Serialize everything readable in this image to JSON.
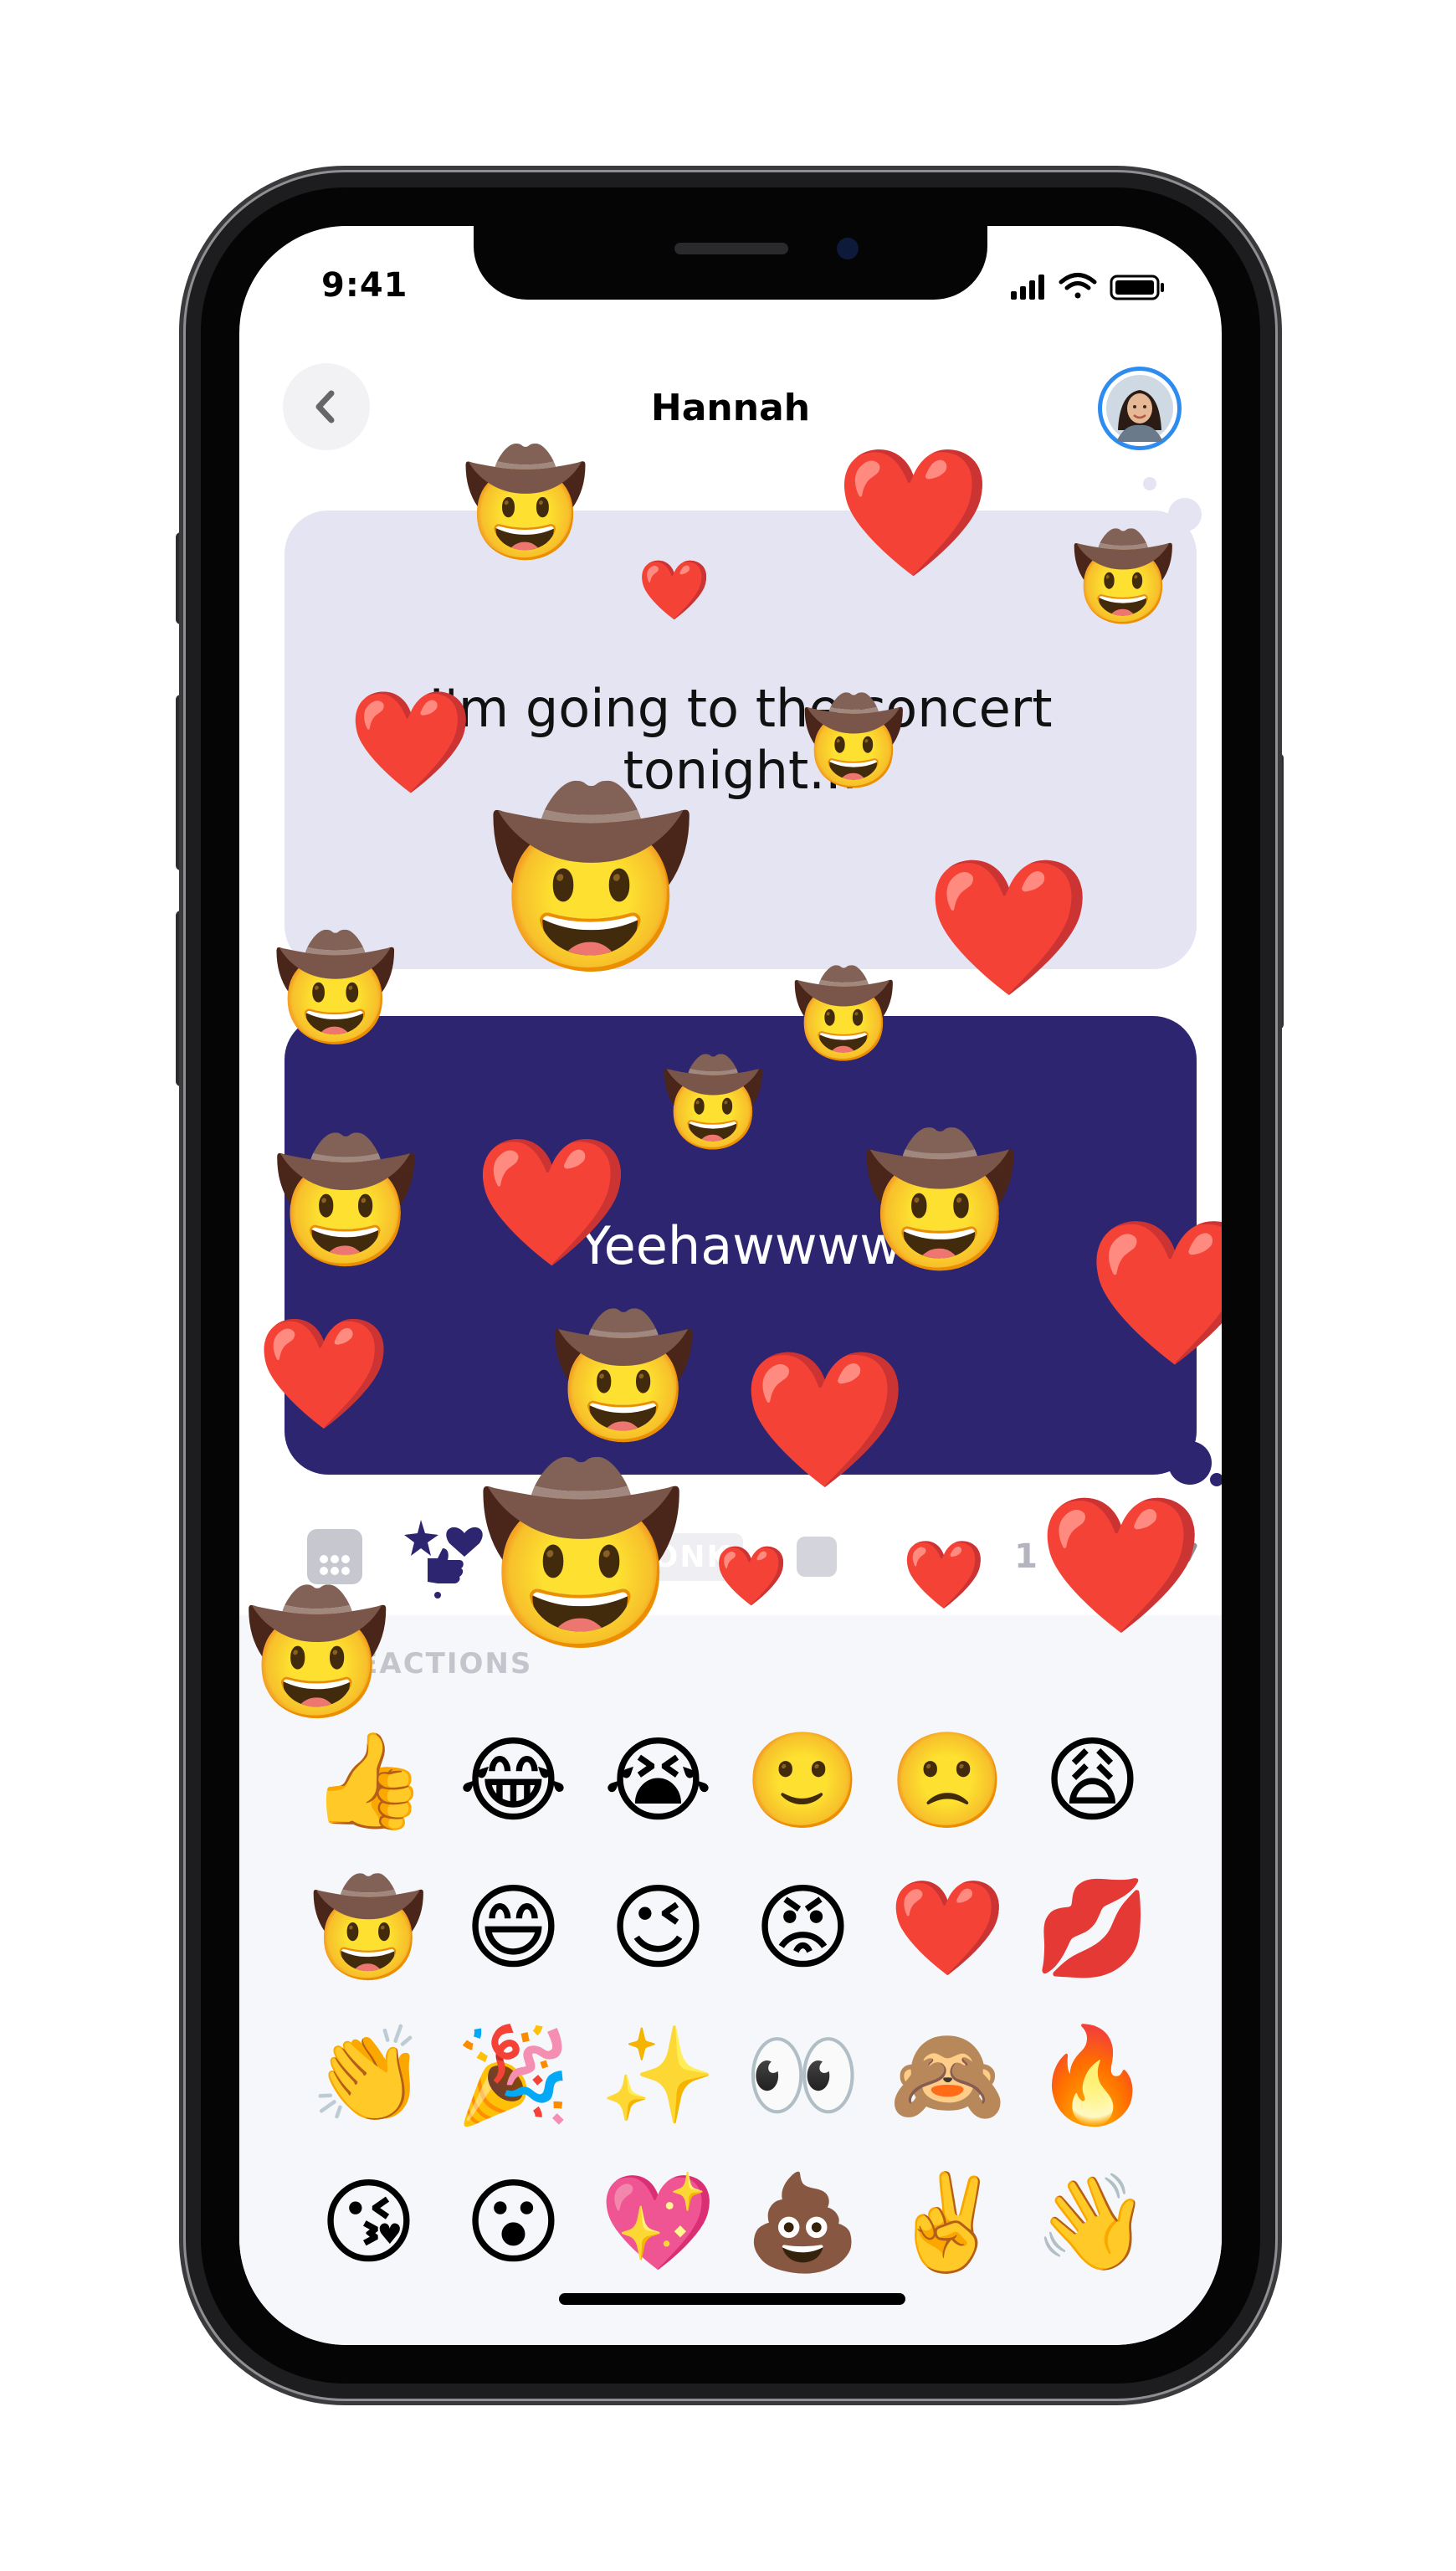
{
  "status_bar": {
    "time": "9:41"
  },
  "header": {
    "contact_name": "Hannah"
  },
  "messages": [
    {
      "direction": "incoming",
      "text": "I'm going to the concert tonight..."
    },
    {
      "direction": "outgoing",
      "text": "Yeehawwww"
    }
  ],
  "toolbar": {
    "honk_label": "HONK",
    "counter_text": "1"
  },
  "reactions": {
    "title": "REACTIONS",
    "emojis": [
      "👍",
      "😂",
      "😭",
      "🙂",
      "🙁",
      "😩",
      "🤠",
      "😄",
      "😉",
      "😡",
      "❤️",
      "💋",
      "👏",
      "🎉",
      "✨",
      "👀",
      "🙈",
      "🔥",
      "😘",
      "😮",
      "💖",
      "💩",
      "✌️",
      "👋"
    ]
  },
  "floating_emojis": {
    "cowboy": "🤠",
    "heart": "❤️"
  },
  "colors": {
    "incoming_bubble": "#e4e4f3",
    "outgoing_bubble": "#2d2570",
    "avatar_ring": "#2e8bf0"
  }
}
